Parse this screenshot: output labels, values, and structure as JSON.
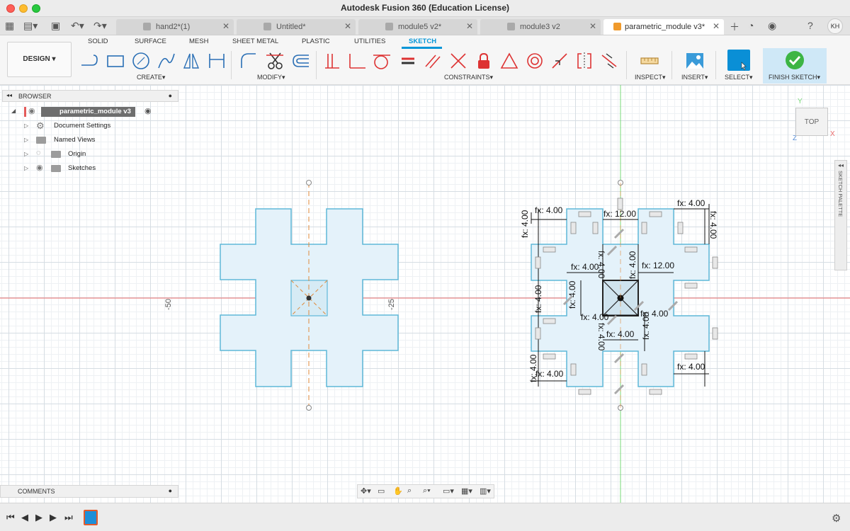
{
  "window": {
    "title": "Autodesk Fusion 360 (Education License)"
  },
  "tabs": [
    {
      "label": "hand2*(1)",
      "active": false
    },
    {
      "label": "Untitled*",
      "active": false
    },
    {
      "label": "module5 v2*",
      "active": false
    },
    {
      "label": "module3 v2",
      "active": false
    },
    {
      "label": "parametric_module v3*",
      "active": true
    }
  ],
  "user": {
    "initials": "KH"
  },
  "toolbar": {
    "workspace": "DESIGN",
    "workspace_tabs": [
      "SOLID",
      "SURFACE",
      "MESH",
      "SHEET METAL",
      "PLASTIC",
      "UTILITIES",
      "SKETCH"
    ],
    "groups": {
      "create": "CREATE",
      "modify": "MODIFY",
      "constraints": "CONSTRAINTS",
      "inspect": "INSPECT",
      "insert": "INSERT",
      "select": "SELECT",
      "finish": "FINISH SKETCH"
    }
  },
  "browser": {
    "header": "BROWSER",
    "root": "parametric_module v3",
    "items": [
      "Document Settings",
      "Named Views",
      "Origin",
      "Sketches"
    ]
  },
  "canvas": {
    "coord_labels": [
      "-50",
      "-25"
    ],
    "viewcube": "TOP",
    "axes": {
      "x": "X",
      "y": "Y",
      "z": "Z"
    },
    "sketch_palette": "SKETCH PALETTE",
    "dimensions": {
      "d1": "fx: 4.00",
      "d2": "fx: 12.00",
      "d3": "fx: 4.00",
      "d4": "fx: 4.00",
      "d5": "fx: 4.00",
      "d6": "fx: 4.00",
      "d7": "fx: 4.00",
      "d8": "fx: 4.00",
      "d9": "fx: 12.00",
      "d10": "fx: 4.00",
      "d11": "fx: 4.00",
      "d12": "fx: 4.00",
      "d13": "fx: 4.00",
      "d14": "fx: 4.00",
      "d15": "fx: 4.00",
      "d16": "fx: 4.00",
      "d17": "fx: 4.00",
      "d18": "fx: 4.00",
      "d19": "fx: 4.00"
    }
  },
  "comments": {
    "label": "COMMENTS"
  },
  "colors": {
    "accent": "#0696d7",
    "sketch_fill": "#e4f2fa",
    "sketch_stroke": "#5fb8d8",
    "x_axis": "#e86b6b",
    "y_axis": "#7ad87a",
    "construction": "#e08a3a"
  }
}
